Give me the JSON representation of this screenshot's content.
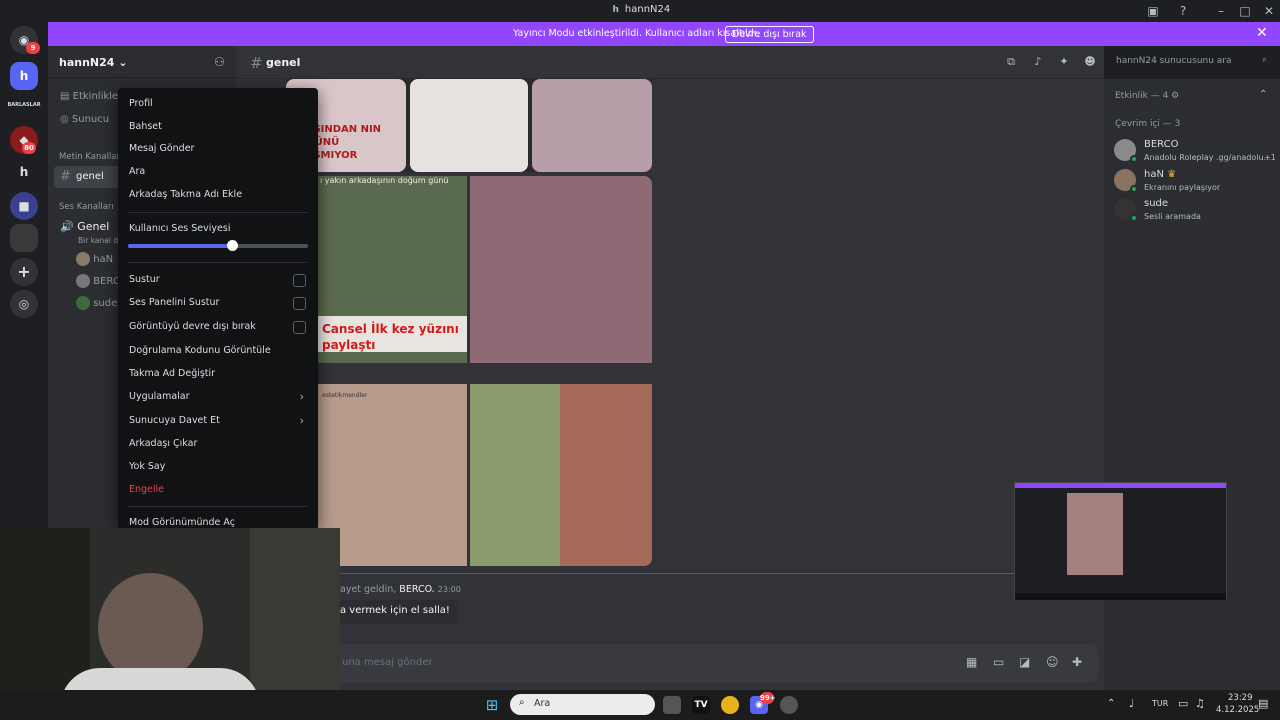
{
  "window": {
    "title": "hannN24"
  },
  "banner": {
    "text": "Yayıncı Modu etkinleştirildi. Kullanıcı adları kısaltıldı.",
    "button": "Devre dışı bırak"
  },
  "guilds": [
    {
      "label": "",
      "badge": "9"
    },
    {
      "label": "h"
    },
    {
      "label": "BARLASLAR"
    },
    {
      "label": "",
      "badge": "80"
    },
    {
      "label": "h"
    }
  ],
  "server": {
    "name": "hannN24"
  },
  "sidebar": {
    "events": "Etkinlikle",
    "server_guide": "Sunucu",
    "text_section": "Metin Kanalları",
    "text_channel": "genel",
    "voice_section": "Ses Kanalları",
    "voice_channel": "Genel",
    "voice_sub": "Bir kanal da",
    "voice_users": [
      "haN",
      "BERC",
      "sude"
    ]
  },
  "channel": {
    "name": "genel"
  },
  "search": {
    "placeholder": "hannN24 sunucusunu ara"
  },
  "images": {
    "caption1": "NDIĞINDAN NIN YÜZÜNÜ YLAŞMIYOR",
    "caption2": "ı yakın arkadaşının doğum günü",
    "caption3": "Cansel İlk kez yüzını paylaştı",
    "caption4": "estetikmendler"
  },
  "chat": {
    "welcome_prefix": "ayet geldin,",
    "welcome_user": "BERCO.",
    "welcome_time": "23:00",
    "wave": "a vermek için el salla!",
    "input_placeholder": "una mesaj gönder"
  },
  "members": {
    "activity": "Etkinlik — 4",
    "online": "Çevrim içi — 3",
    "list": [
      {
        "name": "BERCO",
        "status": "Anadolu Roleplay .gg/anadolu...",
        "extra": "+1"
      },
      {
        "name": "haN",
        "status": "Ekranını paylaşıyor"
      },
      {
        "name": "sude",
        "status": "Sesli aramada"
      }
    ]
  },
  "context_menu": {
    "items": [
      "Profil",
      "Bahset",
      "Mesaj Gönder",
      "Ara",
      "Arkadaş Takma Adı Ekle"
    ],
    "volume_label": "Kullanıcı Ses Seviyesi",
    "volume_level": 0.58,
    "toggles": [
      "Sustur",
      "Ses Panelini Sustur",
      "Görüntüyü devre dışı bırak"
    ],
    "items2": [
      "Doğrulama Kodunu Görüntüle",
      "Takma Ad Değiştir",
      "Uygulamalar",
      "Sunucuya Davet Et",
      "Arkadaşı Çıkar",
      "Yok Say",
      "Engelle",
      "Mod Görünümünde Aç"
    ]
  },
  "taskbar": {
    "search": "Ara",
    "lang": "TUR",
    "time": "23:29",
    "date": "4.12.2025",
    "badge": "99+"
  }
}
